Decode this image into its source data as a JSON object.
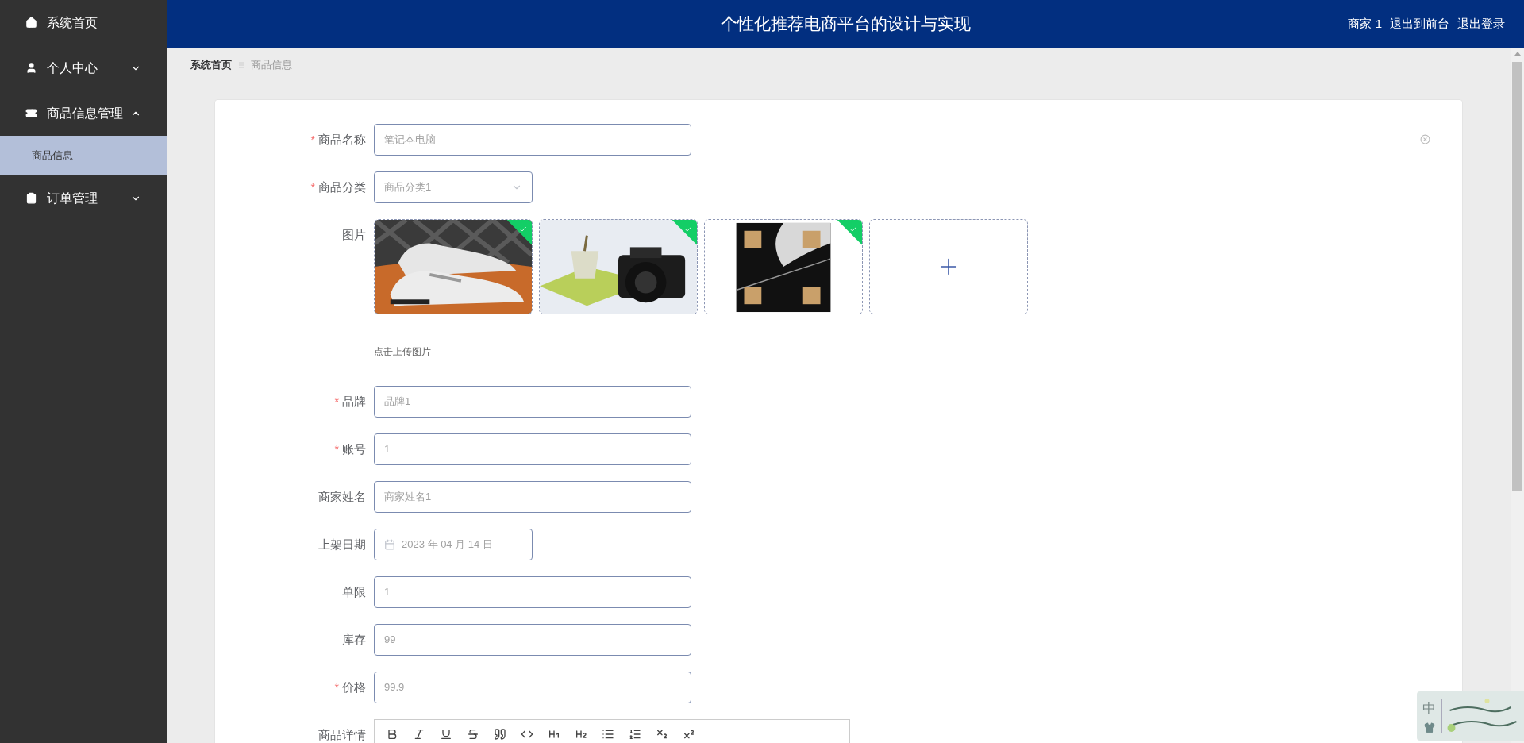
{
  "sidebar": {
    "items": [
      {
        "label": "系统首页",
        "kind": "link"
      },
      {
        "label": "个人中心",
        "kind": "menu",
        "expanded": false
      },
      {
        "label": "商品信息管理",
        "kind": "menu",
        "expanded": true,
        "children": [
          {
            "label": "商品信息",
            "selected": true
          }
        ]
      },
      {
        "label": "订单管理",
        "kind": "menu",
        "expanded": false
      }
    ]
  },
  "header": {
    "title": "个性化推荐电商平台的设计与实现",
    "user": "商家 1",
    "links": [
      "退出到前台",
      "退出登录"
    ]
  },
  "breadcrumb": [
    "系统首页",
    "商品信息"
  ],
  "form": {
    "required_mark": "*",
    "fields": [
      {
        "kind": "text",
        "label": "商品名称",
        "required": true,
        "value": "笔记本电脑"
      },
      {
        "kind": "select",
        "label": "商品分类",
        "required": true,
        "value": "商品分类1"
      },
      {
        "kind": "upload",
        "label": "图片",
        "required": false,
        "images": [
          {
            "kind": "picture",
            "uploaded": true
          },
          {
            "kind": "picture",
            "uploaded": true
          },
          {
            "kind": "picture",
            "uploaded": true
          }
        ],
        "hint": "点击上传图片"
      },
      {
        "kind": "text",
        "label": "品牌",
        "required": true,
        "value": "品牌1"
      },
      {
        "kind": "text",
        "label": "账号",
        "required": true,
        "value": "1"
      },
      {
        "kind": "text",
        "label": "商家姓名",
        "required": false,
        "value": "商家姓名1"
      },
      {
        "kind": "date",
        "label": "上架日期",
        "required": false,
        "value": "2023 年 04 月 14 日"
      },
      {
        "kind": "text",
        "label": "单限",
        "required": false,
        "value": "1"
      },
      {
        "kind": "text",
        "label": "库存",
        "required": false,
        "value": "99"
      },
      {
        "kind": "text",
        "label": "价格",
        "required": true,
        "value": "99.9"
      },
      {
        "kind": "editor",
        "label": "商品详情",
        "required": false
      }
    ]
  },
  "ime_widget": {
    "label": "中"
  }
}
